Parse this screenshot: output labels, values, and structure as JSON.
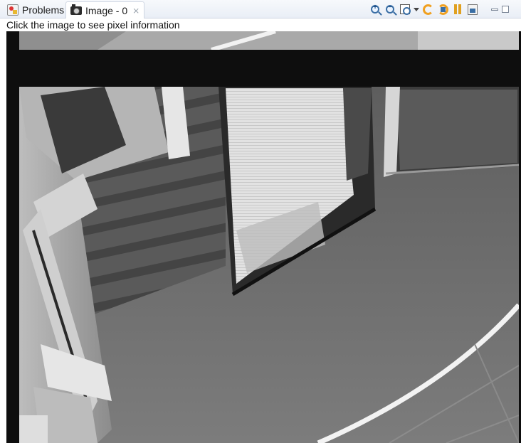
{
  "tabs": [
    {
      "label": "Problems",
      "icon": "problems-icon"
    },
    {
      "label": "Image - 0",
      "icon": "camera-icon",
      "close": "⨯"
    }
  ],
  "toolbar": {
    "zoom_in_label": "+",
    "zoom_out_label": "−"
  },
  "info_text": "Click the image to see pixel information",
  "image_colors": {
    "background": "#0e0e0e",
    "floor": "#707070",
    "wall": "#9a9a9a",
    "panel": "#e8e8e8"
  }
}
